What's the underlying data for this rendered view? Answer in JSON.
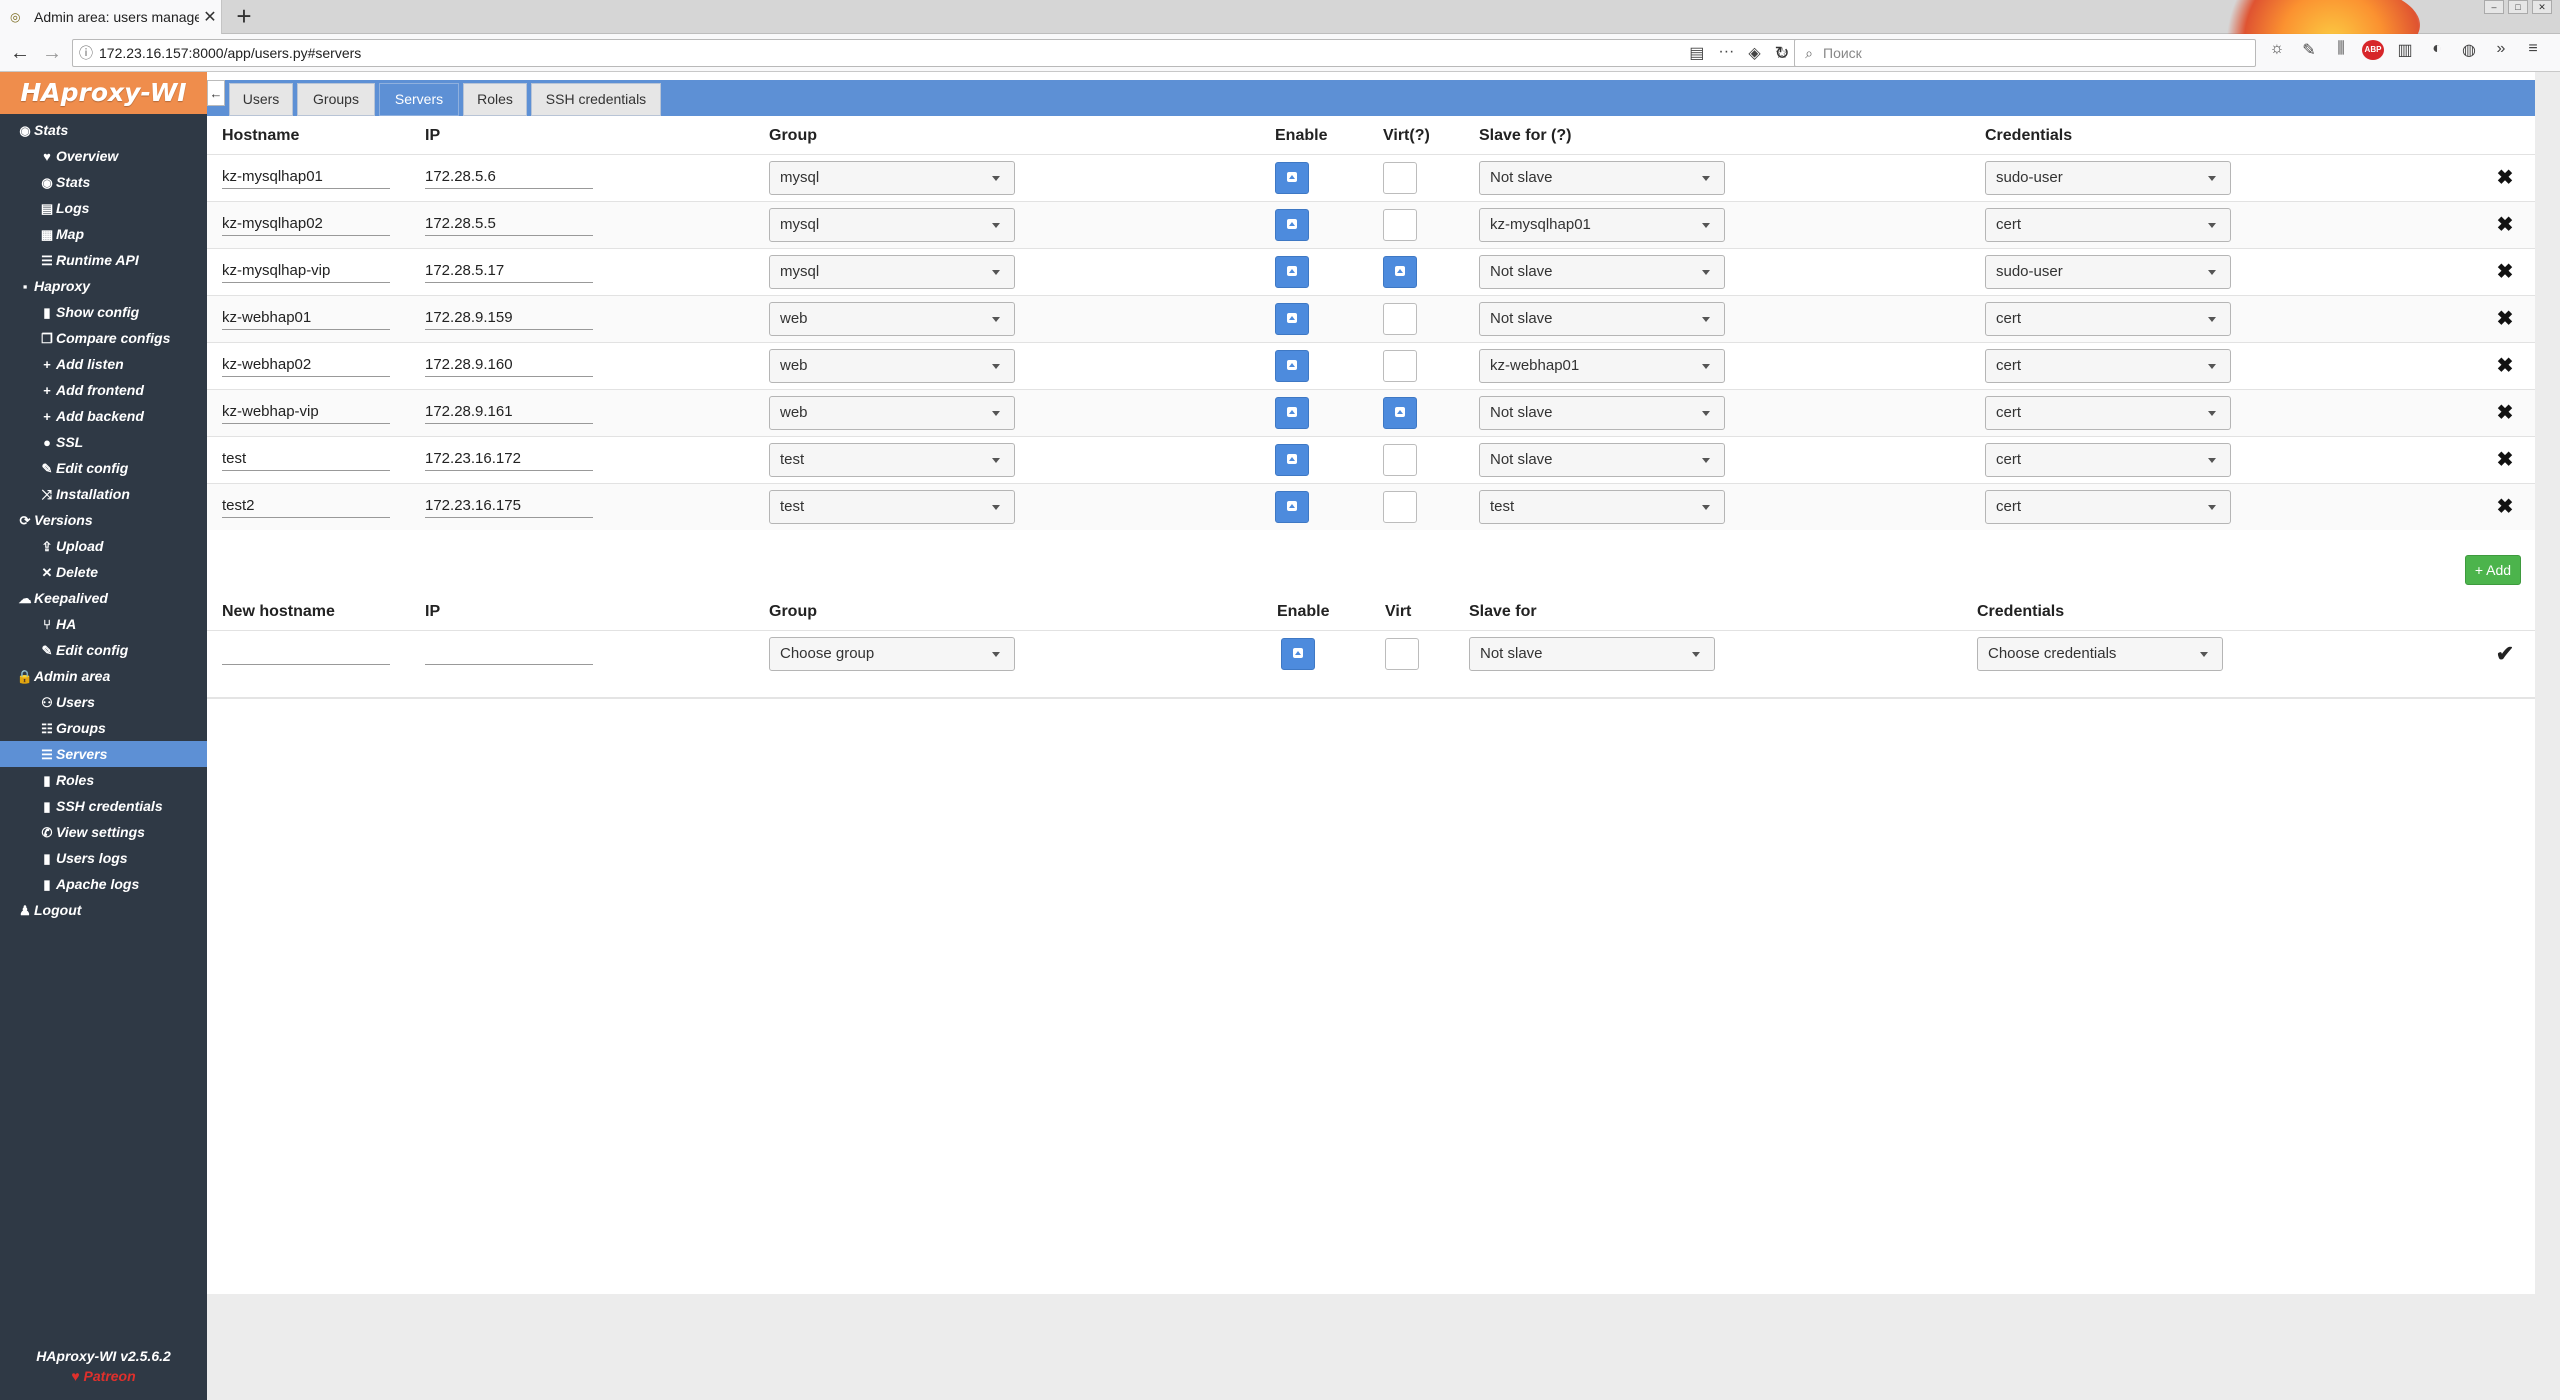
{
  "browser": {
    "tab_title": "Admin area: users manage - H",
    "url": "172.23.16.157:8000/app/users.py#servers",
    "search_placeholder": "Поиск"
  },
  "app": {
    "brand": "HAproxy-WI",
    "version": "HAproxy-WI v2.5.6.2",
    "patreon": "Patreon"
  },
  "sidebar": {
    "items": [
      {
        "label": "Stats",
        "level": 0,
        "icon": "eye-icon"
      },
      {
        "label": "Overview",
        "level": 1,
        "icon": "heartbeat-icon"
      },
      {
        "label": "Stats",
        "level": 1,
        "icon": "eye-icon"
      },
      {
        "label": "Logs",
        "level": 1,
        "icon": "book-icon"
      },
      {
        "label": "Map",
        "level": 1,
        "icon": "map-icon"
      },
      {
        "label": "Runtime API",
        "level": 1,
        "icon": "list-icon"
      },
      {
        "label": "Haproxy",
        "level": 0,
        "icon": "server-icon"
      },
      {
        "label": "Show config",
        "level": 1,
        "icon": "file-icon"
      },
      {
        "label": "Compare configs",
        "level": 1,
        "icon": "copy-icon"
      },
      {
        "label": "Add listen",
        "level": 1,
        "icon": "plus-icon"
      },
      {
        "label": "Add frontend",
        "level": 1,
        "icon": "plus-icon"
      },
      {
        "label": "Add backend",
        "level": 1,
        "icon": "plus-icon"
      },
      {
        "label": "SSL",
        "level": 1,
        "icon": "circle-icon"
      },
      {
        "label": "Edit config",
        "level": 1,
        "icon": "edit-icon"
      },
      {
        "label": "Installation",
        "level": 1,
        "icon": "shuffle-icon"
      },
      {
        "label": "Versions",
        "level": 0,
        "icon": "sync-icon"
      },
      {
        "label": "Upload",
        "level": 1,
        "icon": "upload-icon"
      },
      {
        "label": "Delete",
        "level": 1,
        "icon": "close-icon"
      },
      {
        "label": "Keepalived",
        "level": 0,
        "icon": "cloud-icon"
      },
      {
        "label": "HA",
        "level": 1,
        "icon": "branch-icon"
      },
      {
        "label": "Edit config",
        "level": 1,
        "icon": "edit-icon"
      },
      {
        "label": "Admin area",
        "level": 0,
        "icon": "lock-icon"
      },
      {
        "label": "Users",
        "level": 1,
        "icon": "user-plus-icon"
      },
      {
        "label": "Groups",
        "level": 1,
        "icon": "group-icon"
      },
      {
        "label": "Servers",
        "level": 1,
        "icon": "list-icon",
        "active": true
      },
      {
        "label": "Roles",
        "level": 1,
        "icon": "file-icon"
      },
      {
        "label": "SSH credentials",
        "level": 1,
        "icon": "file-icon"
      },
      {
        "label": "View settings",
        "level": 1,
        "icon": "wrench-icon"
      },
      {
        "label": "Users logs",
        "level": 1,
        "icon": "file-icon"
      },
      {
        "label": "Apache logs",
        "level": 1,
        "icon": "file-icon"
      },
      {
        "label": "Logout",
        "level": 0,
        "icon": "user-icon"
      }
    ]
  },
  "tabs": {
    "users": "Users",
    "groups": "Groups",
    "servers": "Servers",
    "roles": "Roles",
    "ssh": "SSH credentials"
  },
  "servers_table": {
    "headers": {
      "hostname": "Hostname",
      "ip": "IP",
      "group": "Group",
      "enable": "Enable",
      "virt": "Virt(?)",
      "slave": "Slave for (?)",
      "credentials": "Credentials"
    },
    "rows": [
      {
        "hostname": "kz-mysqlhap01",
        "ip": "172.28.5.6",
        "group": "mysql",
        "enable": true,
        "virt": false,
        "slave": "Not slave",
        "cred": "sudo-user"
      },
      {
        "hostname": "kz-mysqlhap02",
        "ip": "172.28.5.5",
        "group": "mysql",
        "enable": true,
        "virt": false,
        "slave": "kz-mysqlhap01",
        "cred": "cert"
      },
      {
        "hostname": "kz-mysqlhap-vip",
        "ip": "172.28.5.17",
        "group": "mysql",
        "enable": true,
        "virt": true,
        "slave": "Not slave",
        "cred": "sudo-user"
      },
      {
        "hostname": "kz-webhap01",
        "ip": "172.28.9.159",
        "group": "web",
        "enable": true,
        "virt": false,
        "slave": "Not slave",
        "cred": "cert"
      },
      {
        "hostname": "kz-webhap02",
        "ip": "172.28.9.160",
        "group": "web",
        "enable": true,
        "virt": false,
        "slave": "kz-webhap01",
        "cred": "cert"
      },
      {
        "hostname": "kz-webhap-vip",
        "ip": "172.28.9.161",
        "group": "web",
        "enable": true,
        "virt": true,
        "slave": "Not slave",
        "cred": "cert"
      },
      {
        "hostname": "test",
        "ip": "172.23.16.172",
        "group": "test",
        "enable": true,
        "virt": false,
        "slave": "Not slave",
        "cred": "cert"
      },
      {
        "hostname": "test2",
        "ip": "172.23.16.175",
        "group": "test",
        "enable": true,
        "virt": false,
        "slave": "test",
        "cred": "cert"
      }
    ]
  },
  "add_button": "+ Add",
  "new_server": {
    "headers": {
      "hostname": "New hostname",
      "ip": "IP",
      "group": "Group",
      "enable": "Enable",
      "virt": "Virt",
      "slave": "Slave for",
      "credentials": "Credentials"
    },
    "group": "Choose group",
    "slave": "Not slave",
    "cred": "Choose credentials",
    "enable": true,
    "virt": false
  }
}
